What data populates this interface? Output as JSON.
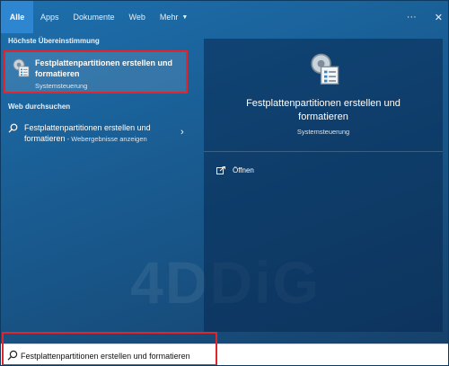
{
  "tabs": [
    {
      "label": "Alle"
    },
    {
      "label": "Apps"
    },
    {
      "label": "Dokumente"
    },
    {
      "label": "Web"
    },
    {
      "label": "Mehr"
    }
  ],
  "toolbar": {
    "more_options": "···",
    "close": "✕"
  },
  "sections": {
    "best_match": "Höchste Übereinstimmung",
    "web": "Web durchsuchen"
  },
  "best_match": {
    "title": "Festplattenpartitionen erstellen und formatieren",
    "subtitle": "Systemsteuerung",
    "icon": "disk-management-icon"
  },
  "web_result": {
    "query": "Festplattenpartitionen erstellen und formatieren",
    "suffix": " - Webergebnisse anzeigen"
  },
  "preview": {
    "title": "Festplattenpartitionen erstellen und formatieren",
    "subtitle": "Systemsteuerung",
    "action_open": "Öffnen"
  },
  "search": {
    "value": "Festplattenpartitionen erstellen und formatieren"
  },
  "watermark": "4DDiG",
  "colors": {
    "accent": "#2f86d0",
    "highlight": "#e0262b"
  }
}
